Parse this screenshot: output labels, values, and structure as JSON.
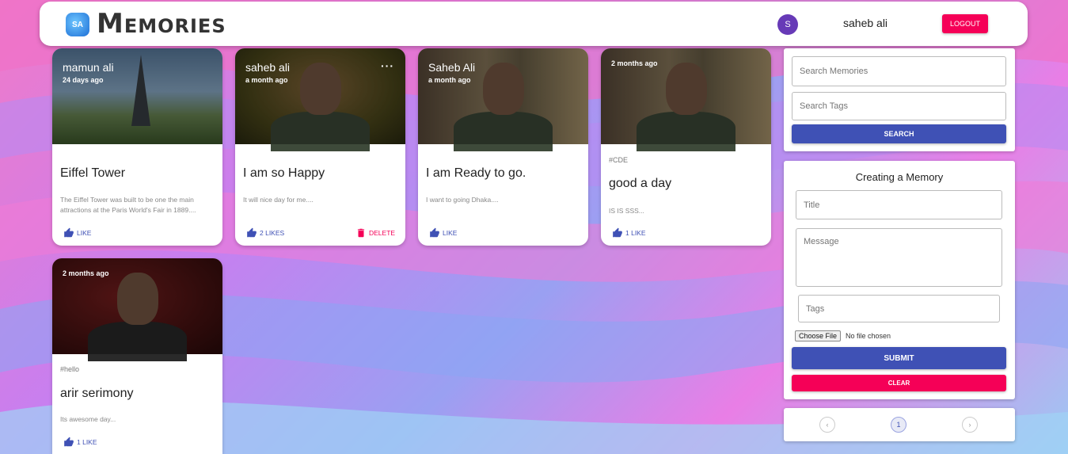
{
  "app": {
    "title": "Memories",
    "logo_text": "SA"
  },
  "user": {
    "avatar_initial": "S",
    "name": "saheb ali",
    "logout_label": "LOGOUT"
  },
  "posts": [
    {
      "author": "mamun ali",
      "time": "24 days ago",
      "tags": "",
      "title": "Eiffel Tower",
      "message": "The Eiffel Tower was built to be one the main attractions at the Paris World's Fair in 1889....",
      "like_label": "LIKE"
    },
    {
      "author": "saheb ali",
      "time": "a month ago",
      "tags": "",
      "title": "I am so Happy",
      "message": "It will nice day for me....",
      "like_label": "2 LIKES",
      "delete_label": "DELETE",
      "more_label": "···"
    },
    {
      "author": "Saheb Ali",
      "time": "a month ago",
      "tags": "",
      "title": "I am Ready to go.",
      "message": "I want to going Dhaka....",
      "like_label": "LIKE"
    },
    {
      "author": "",
      "time": "2 months ago",
      "tags": "#CDE",
      "title": "good a day",
      "message": "IS IS SSS...",
      "like_label": "1 LIKE"
    },
    {
      "author": "",
      "time": "2 months ago",
      "tags": "#hello",
      "title": "arir serimony",
      "message": "Its awesome day...",
      "like_label": "1 LIKE"
    }
  ],
  "search": {
    "memories_placeholder": "Search Memories",
    "tags_placeholder": "Search Tags",
    "button_label": "SEARCH"
  },
  "form": {
    "heading": "Creating a Memory",
    "title_placeholder": "Title",
    "message_placeholder": "Message",
    "tags_placeholder": "Tags",
    "file_button_label": "Choose File",
    "file_status": "No file chosen",
    "submit_label": "SUBMIT",
    "clear_label": "CLEAR"
  },
  "pagination": {
    "prev_icon": "‹",
    "current_page": "1",
    "next_icon": "›"
  },
  "colors": {
    "primary": "#3f51b5",
    "secondary": "#f50057",
    "avatar": "#673ab7"
  }
}
